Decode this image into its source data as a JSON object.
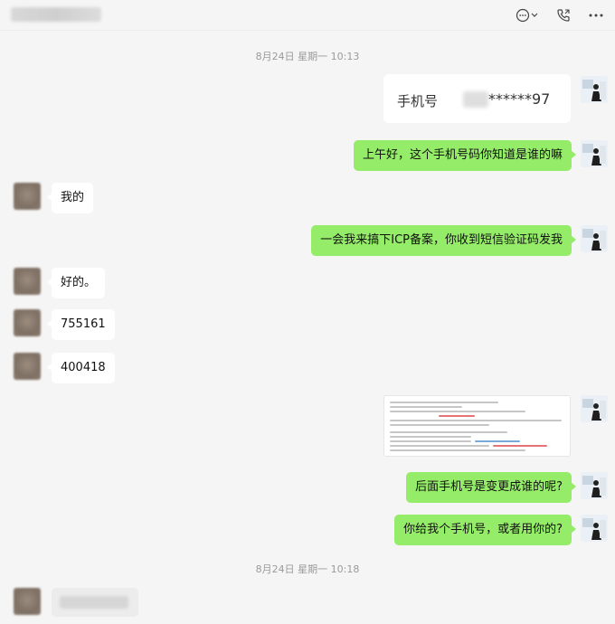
{
  "header": {
    "icons": [
      "chat-more-icon",
      "chevron-down-icon",
      "phone-call-icon",
      "more-icon"
    ]
  },
  "timestamps": {
    "first": "8月24日 星期一 10:13",
    "second": "8月24日 星期一 10:18"
  },
  "messages": {
    "phone_card_label": "手机号",
    "phone_card_number": "******97",
    "m1": "上午好，这个手机号码你知道是谁的嘛",
    "m2": "我的",
    "m3": "一会我来搞下ICP备案，你收到短信验证码发我",
    "m4": "好的。",
    "m5": "755161",
    "m6": "400418",
    "m7": "后面手机号是变更成谁的呢?",
    "m8": "你给我个手机号，或者用你的?"
  },
  "colors": {
    "sent_bubble": "#95ec69",
    "received_bubble": "#ffffff",
    "background": "#f5f5f5"
  }
}
